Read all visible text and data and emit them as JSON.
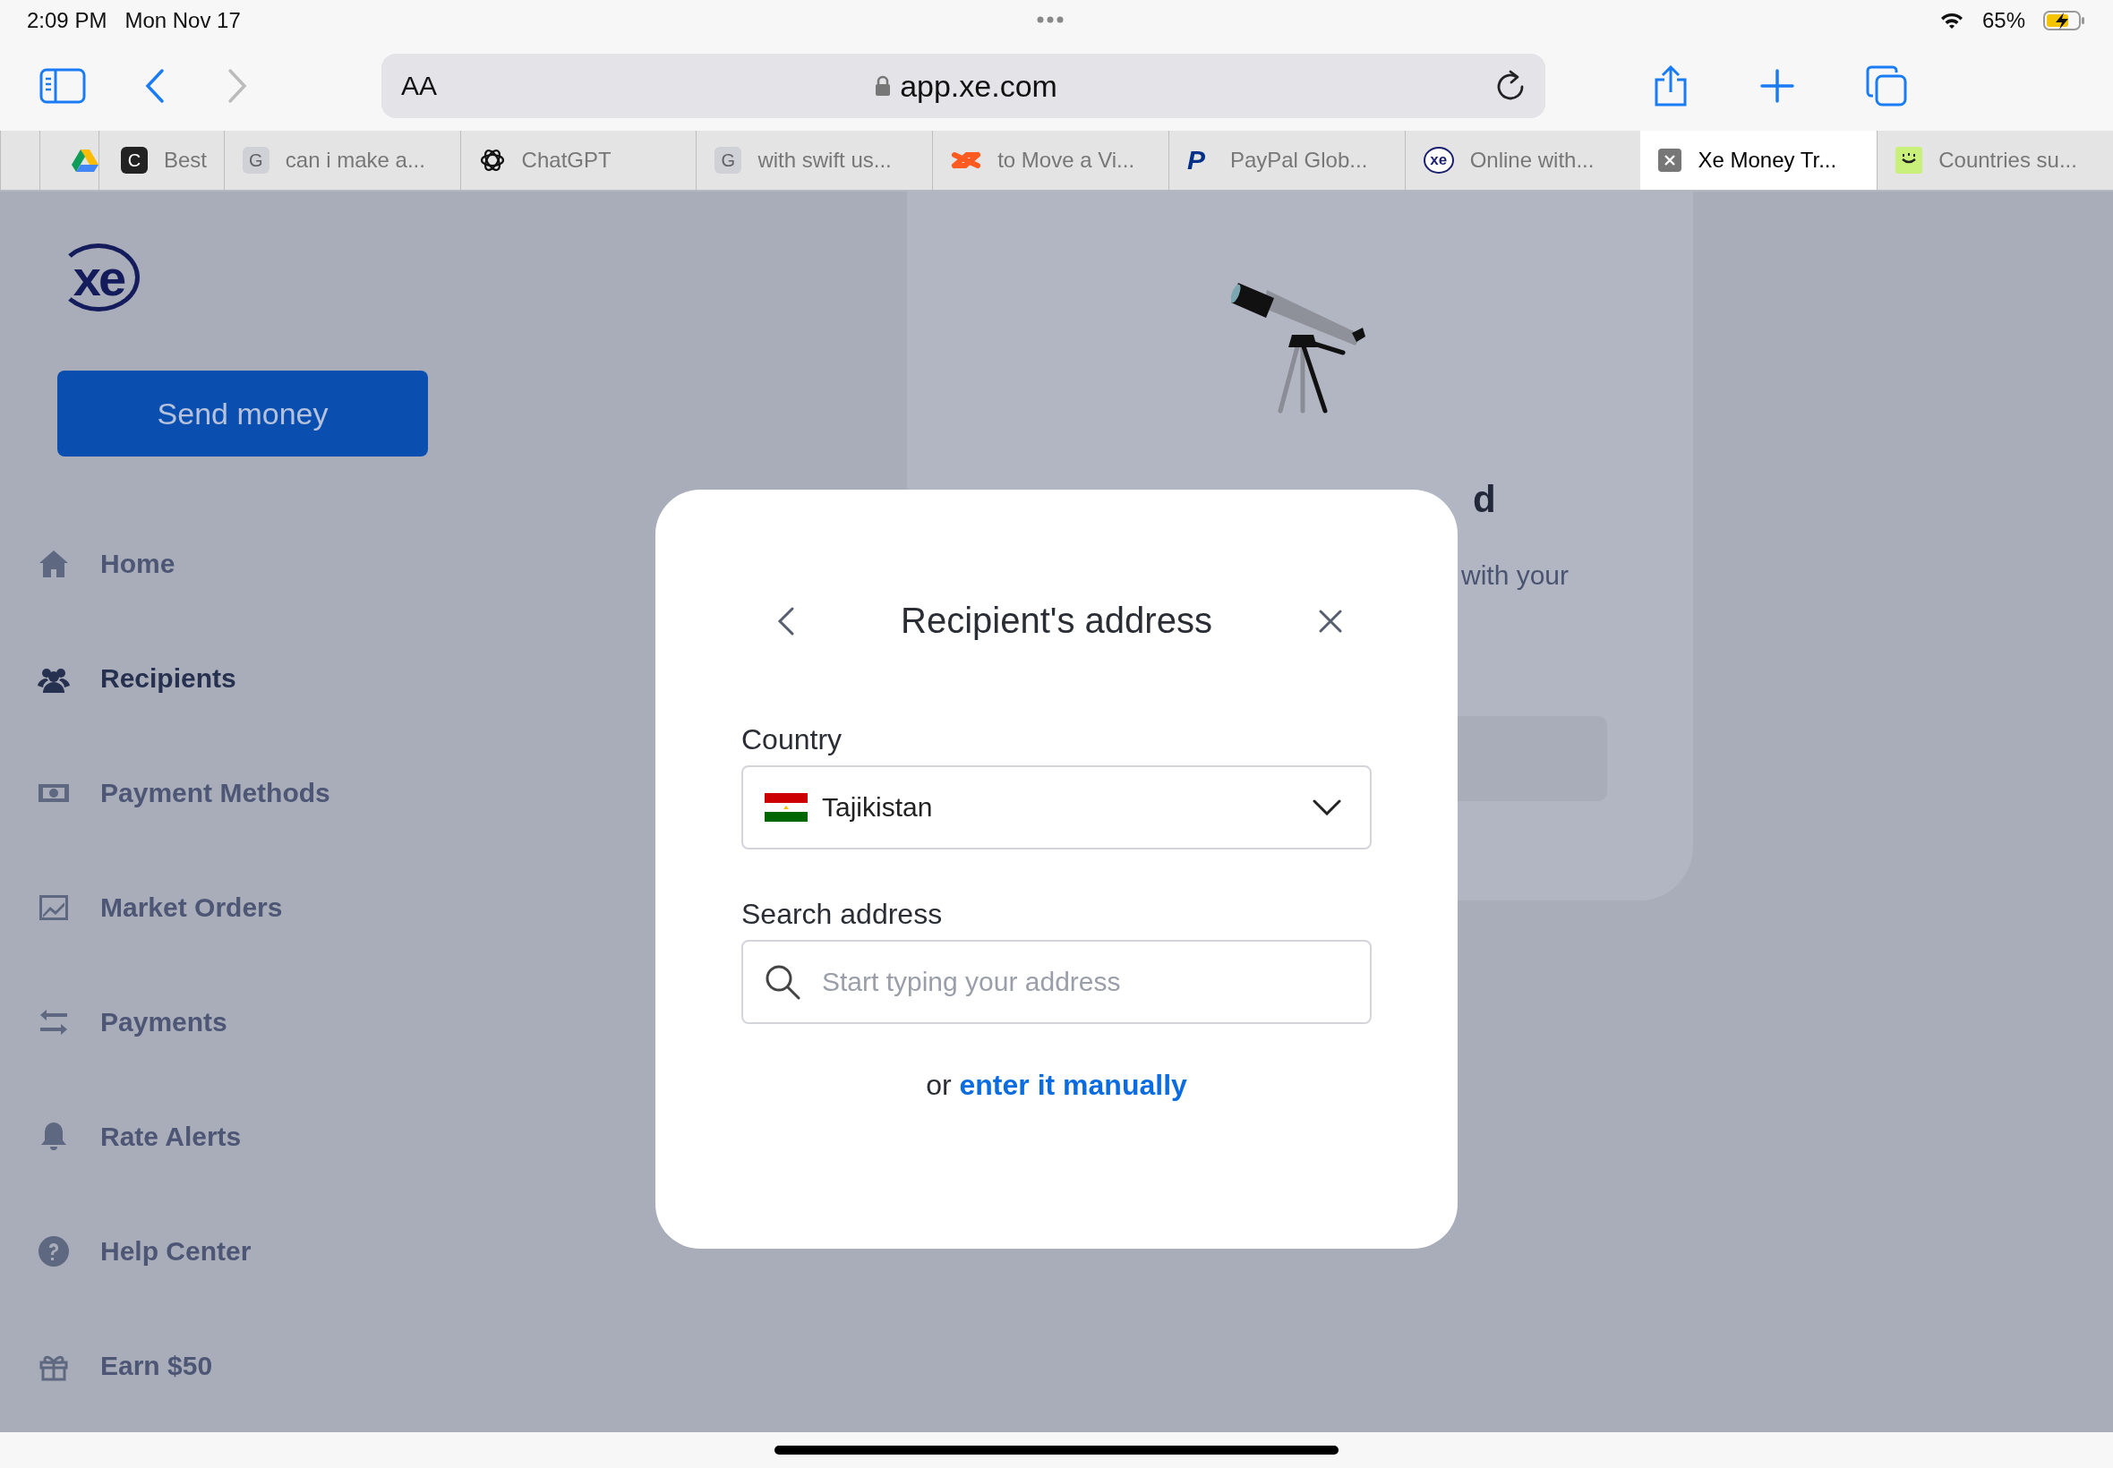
{
  "status_bar": {
    "time": "2:09 PM",
    "date": "Mon Nov 17",
    "battery": "65%"
  },
  "toolbar": {
    "text_size": "AA",
    "address": "app.xe.com"
  },
  "tabs": [
    {
      "kind": "blank",
      "selected": false
    },
    {
      "kind": "drive",
      "selected": false
    },
    {
      "kind": "letter",
      "icon_letter": "C",
      "label": "Best",
      "selected": false
    },
    {
      "kind": "grey_letter",
      "icon_letter": "G",
      "label": "can i make a...",
      "selected": false
    },
    {
      "kind": "knot",
      "label": "ChatGPT",
      "selected": false
    },
    {
      "kind": "grey_letter",
      "icon_letter": "G",
      "label": "with swift us...",
      "selected": false
    },
    {
      "kind": "orange",
      "label": "to Move a Vi...",
      "selected": false
    },
    {
      "kind": "paypal",
      "icon_letter": "P",
      "label": "PayPal Glob...",
      "selected": false
    },
    {
      "kind": "xe",
      "icon_letter": "xe",
      "label": "Online with...",
      "selected": false
    },
    {
      "kind": "close",
      "label": "Xe Money Tr...",
      "selected": true
    },
    {
      "kind": "face",
      "label": "Countries su...",
      "selected": false
    }
  ],
  "sidebar": {
    "logo": "xe",
    "send_button": "Send money",
    "items": [
      {
        "kind": "home",
        "label": "Home",
        "selected": false
      },
      {
        "kind": "people",
        "label": "Recipients",
        "selected": true
      },
      {
        "kind": "cash",
        "label": "Payment Methods",
        "selected": false
      },
      {
        "kind": "chart",
        "label": "Market Orders",
        "selected": false
      },
      {
        "kind": "arrows",
        "label": "Payments",
        "selected": false
      },
      {
        "kind": "bell",
        "label": "Rate Alerts",
        "selected": false
      },
      {
        "kind": "help",
        "label": "Help Center",
        "selected": false
      },
      {
        "kind": "gift",
        "label": "Earn $50",
        "selected": false
      }
    ]
  },
  "background_card": {
    "heading": "d",
    "text": "with your"
  },
  "modal": {
    "title": "Recipient's address",
    "country_label": "Country",
    "country_value": "Tajikistan",
    "search_label": "Search address",
    "search_placeholder": "Start typing your address",
    "manual_prefix": "or",
    "manual_link": "enter it manually"
  }
}
